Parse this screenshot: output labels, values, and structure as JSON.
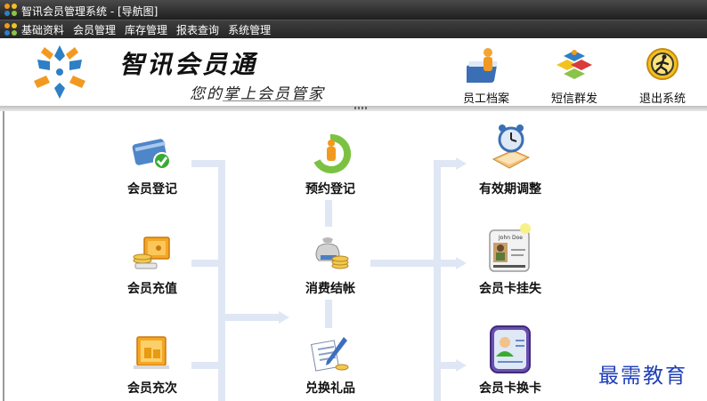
{
  "window": {
    "title": "智讯会员管理系统 - [导航图]"
  },
  "menu": {
    "items": [
      "基础资料",
      "会员管理",
      "库存管理",
      "报表查询",
      "系统管理"
    ]
  },
  "header": {
    "brand": "智讯会员通",
    "slogan": "您的掌上会员管家",
    "buttons": {
      "staff": "员工档案",
      "sms": "短信群发",
      "exit": "退出系统"
    }
  },
  "nodes": {
    "member_register": "会员登记",
    "member_recharge": "会员充值",
    "member_times": "会员充次",
    "reservation": "预约登记",
    "checkout": "消费结帐",
    "redeem_gift": "兑换礼品",
    "validity_adjust": "有效期调整",
    "card_lost": "会员卡挂失",
    "card_replace": "会员卡换卡"
  },
  "card_text": "John Doe",
  "watermark": "最需教育",
  "colors": {
    "titlebar": "#2b2b2b",
    "menubar": "#333333",
    "flow": "#dfe7f5",
    "watermark": "#1e3fb8",
    "logo_blue": "#2f7fc4",
    "logo_orange": "#f29a1f"
  }
}
